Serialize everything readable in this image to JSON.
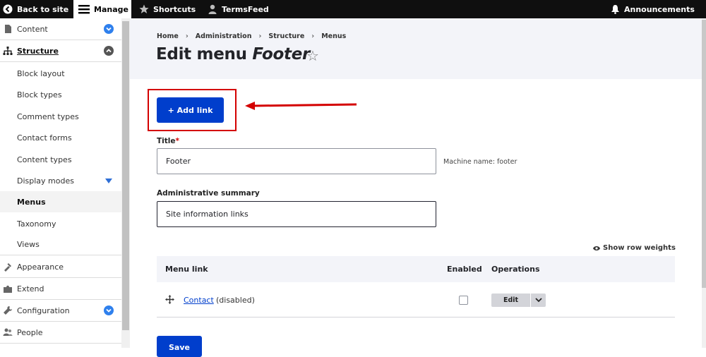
{
  "toolbar": {
    "back_label": "Back to site",
    "manage_label": "Manage",
    "shortcuts_label": "Shortcuts",
    "user_label": "TermsFeed",
    "announcements_label": "Announcements"
  },
  "sidebar": {
    "content": "Content",
    "structure": "Structure",
    "sub_items": [
      "Block layout",
      "Block types",
      "Comment types",
      "Contact forms",
      "Content types",
      "Display modes",
      "Menus",
      "Taxonomy",
      "Views"
    ],
    "appearance": "Appearance",
    "extend": "Extend",
    "configuration": "Configuration",
    "people": "People"
  },
  "breadcrumb": [
    "Home",
    "Administration",
    "Structure",
    "Menus"
  ],
  "breadcrumb_sep": "›",
  "page": {
    "title_prefix": "Edit menu ",
    "title_name": "Footer",
    "star": "☆"
  },
  "add_link_label": "+ Add link",
  "form": {
    "title_label": "Title",
    "required_mark": "*",
    "title_value": "Footer",
    "machine_name": "Machine name: footer",
    "summary_label": "Administrative summary",
    "summary_value": "Site information links"
  },
  "show_row_weights": "Show row weights",
  "table": {
    "headers": [
      "Menu link",
      "Enabled",
      "Operations"
    ],
    "rows": [
      {
        "link": "Contact",
        "status": "(disabled)",
        "enabled": false,
        "operation": "Edit"
      }
    ]
  },
  "save_label": "Save",
  "colors": {
    "accent": "#003ecc",
    "highlight": "#d40000",
    "toolbar": "#0f0f0f"
  }
}
